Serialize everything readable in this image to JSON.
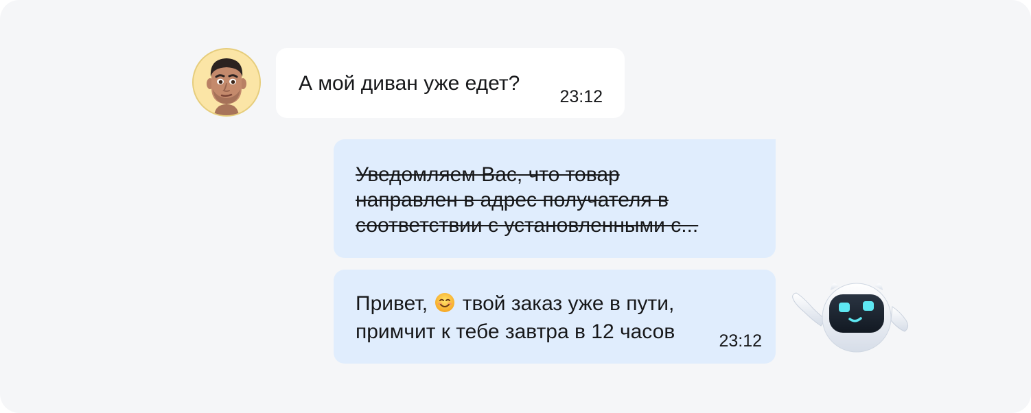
{
  "chat": {
    "user_message": {
      "text": "А мой диван уже едет?",
      "time": "23:12"
    },
    "bot_old_message": {
      "text": "Уведомляем Вас, что товар\nнаправлен в адрес получателя в\nсоответствии с установленными с..."
    },
    "bot_new_message": {
      "line1_before": "Привет,",
      "emoji": "smiling-face-emoji",
      "line1_after": "твой заказ уже в пути,",
      "line2": "примчит к тебе завтра в 12 часов",
      "time": "23:12"
    }
  },
  "colors": {
    "background": "#f5f6f8",
    "user_bubble": "#ffffff",
    "bot_bubble": "#e0edfd",
    "text": "#17181a",
    "avatar_bg": "#fbe5a6",
    "robot_eyes": "#5ee7f2"
  },
  "icons": {
    "user_avatar": "memoji-avatar",
    "bot_avatar": "robot-mascot-icon"
  }
}
